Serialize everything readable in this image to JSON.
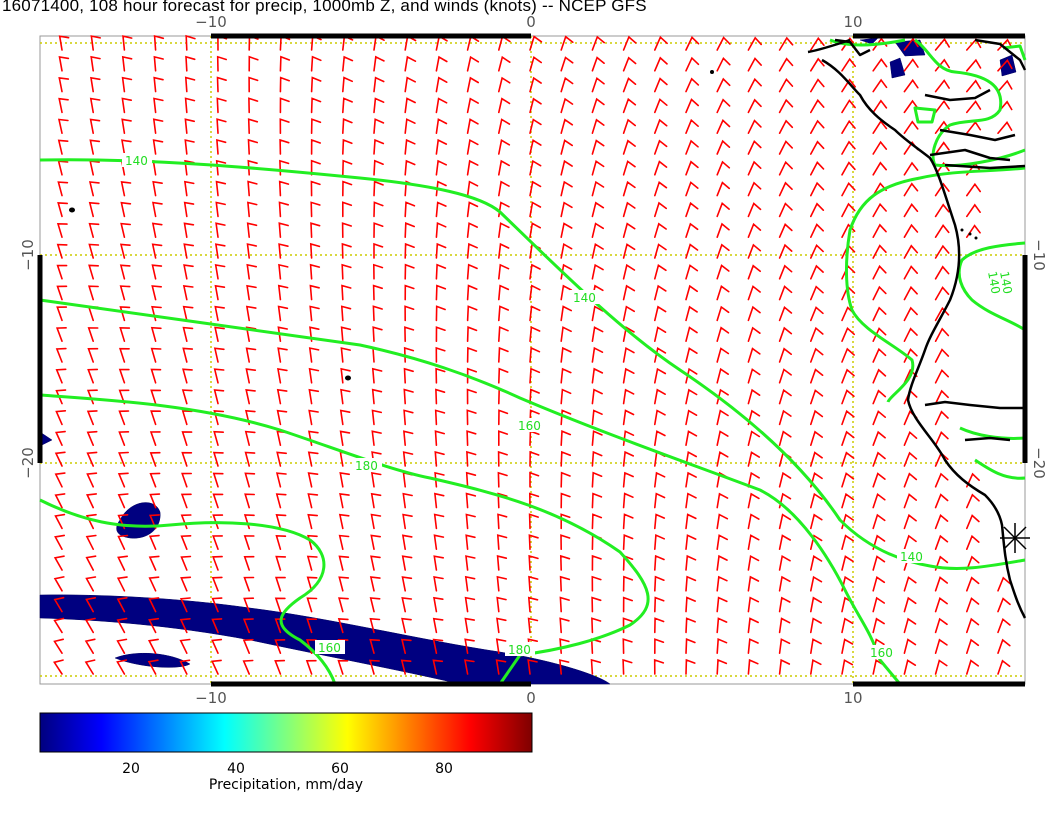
{
  "title": "16071400, 108 hour forecast for precip, 1000mb Z, and winds (knots) -- NCEP GFS",
  "map": {
    "longitude_ticks": [
      "−10",
      "0",
      "10"
    ],
    "latitude_ticks": [
      "−10",
      "−20"
    ],
    "colors": {
      "wind_barbs": "#ff0000",
      "height_contours": "#22ee22",
      "coastline": "#000000",
      "gridlines": "#cccc00",
      "precip_fill": "#000080"
    },
    "contour_labels": [
      {
        "text": "140"
      },
      {
        "text": "140"
      },
      {
        "text": "160"
      },
      {
        "text": "180"
      },
      {
        "text": "140"
      },
      {
        "text": "160"
      },
      {
        "text": "180"
      },
      {
        "text": "160"
      },
      {
        "text": "140"
      },
      {
        "text": "140"
      }
    ],
    "marker_icon": "asterisk-station-icon"
  },
  "colorbar": {
    "ticks": [
      "20",
      "40",
      "60",
      "80"
    ],
    "title": "Precipitation, mm/day",
    "range": [
      3,
      97
    ]
  }
}
